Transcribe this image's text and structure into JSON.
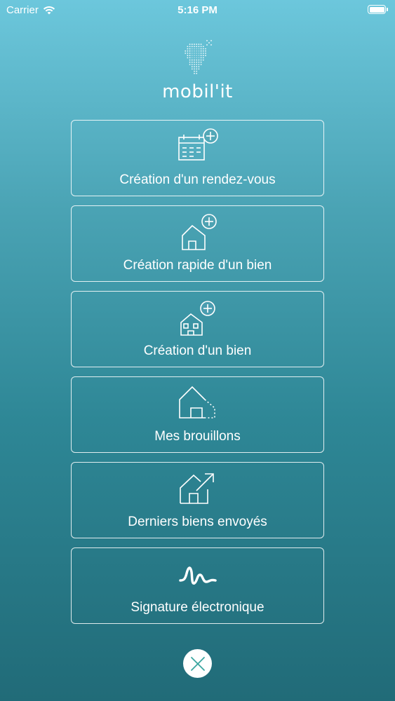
{
  "status_bar": {
    "carrier": "Carrier",
    "time": "5:16 PM",
    "battery_level": 1.0
  },
  "logo": {
    "text": "mobil'it"
  },
  "menu": {
    "items": [
      {
        "label": "Création d'un rendez-vous",
        "icon": "calendar-plus-icon"
      },
      {
        "label": "Création rapide d'un bien",
        "icon": "house-plus-icon"
      },
      {
        "label": "Création d'un bien",
        "icon": "house-windows-plus-icon"
      },
      {
        "label": "Mes brouillons",
        "icon": "house-dotted-icon"
      },
      {
        "label": "Derniers biens envoyés",
        "icon": "house-arrow-icon"
      },
      {
        "label": "Signature électronique",
        "icon": "signature-icon"
      }
    ]
  },
  "close_button": {
    "icon": "close-icon",
    "accent": "#3aa6a0"
  },
  "colors": {
    "gradient_top": "#6cc7dc",
    "gradient_bottom": "#216b78",
    "foreground": "#ffffff"
  }
}
